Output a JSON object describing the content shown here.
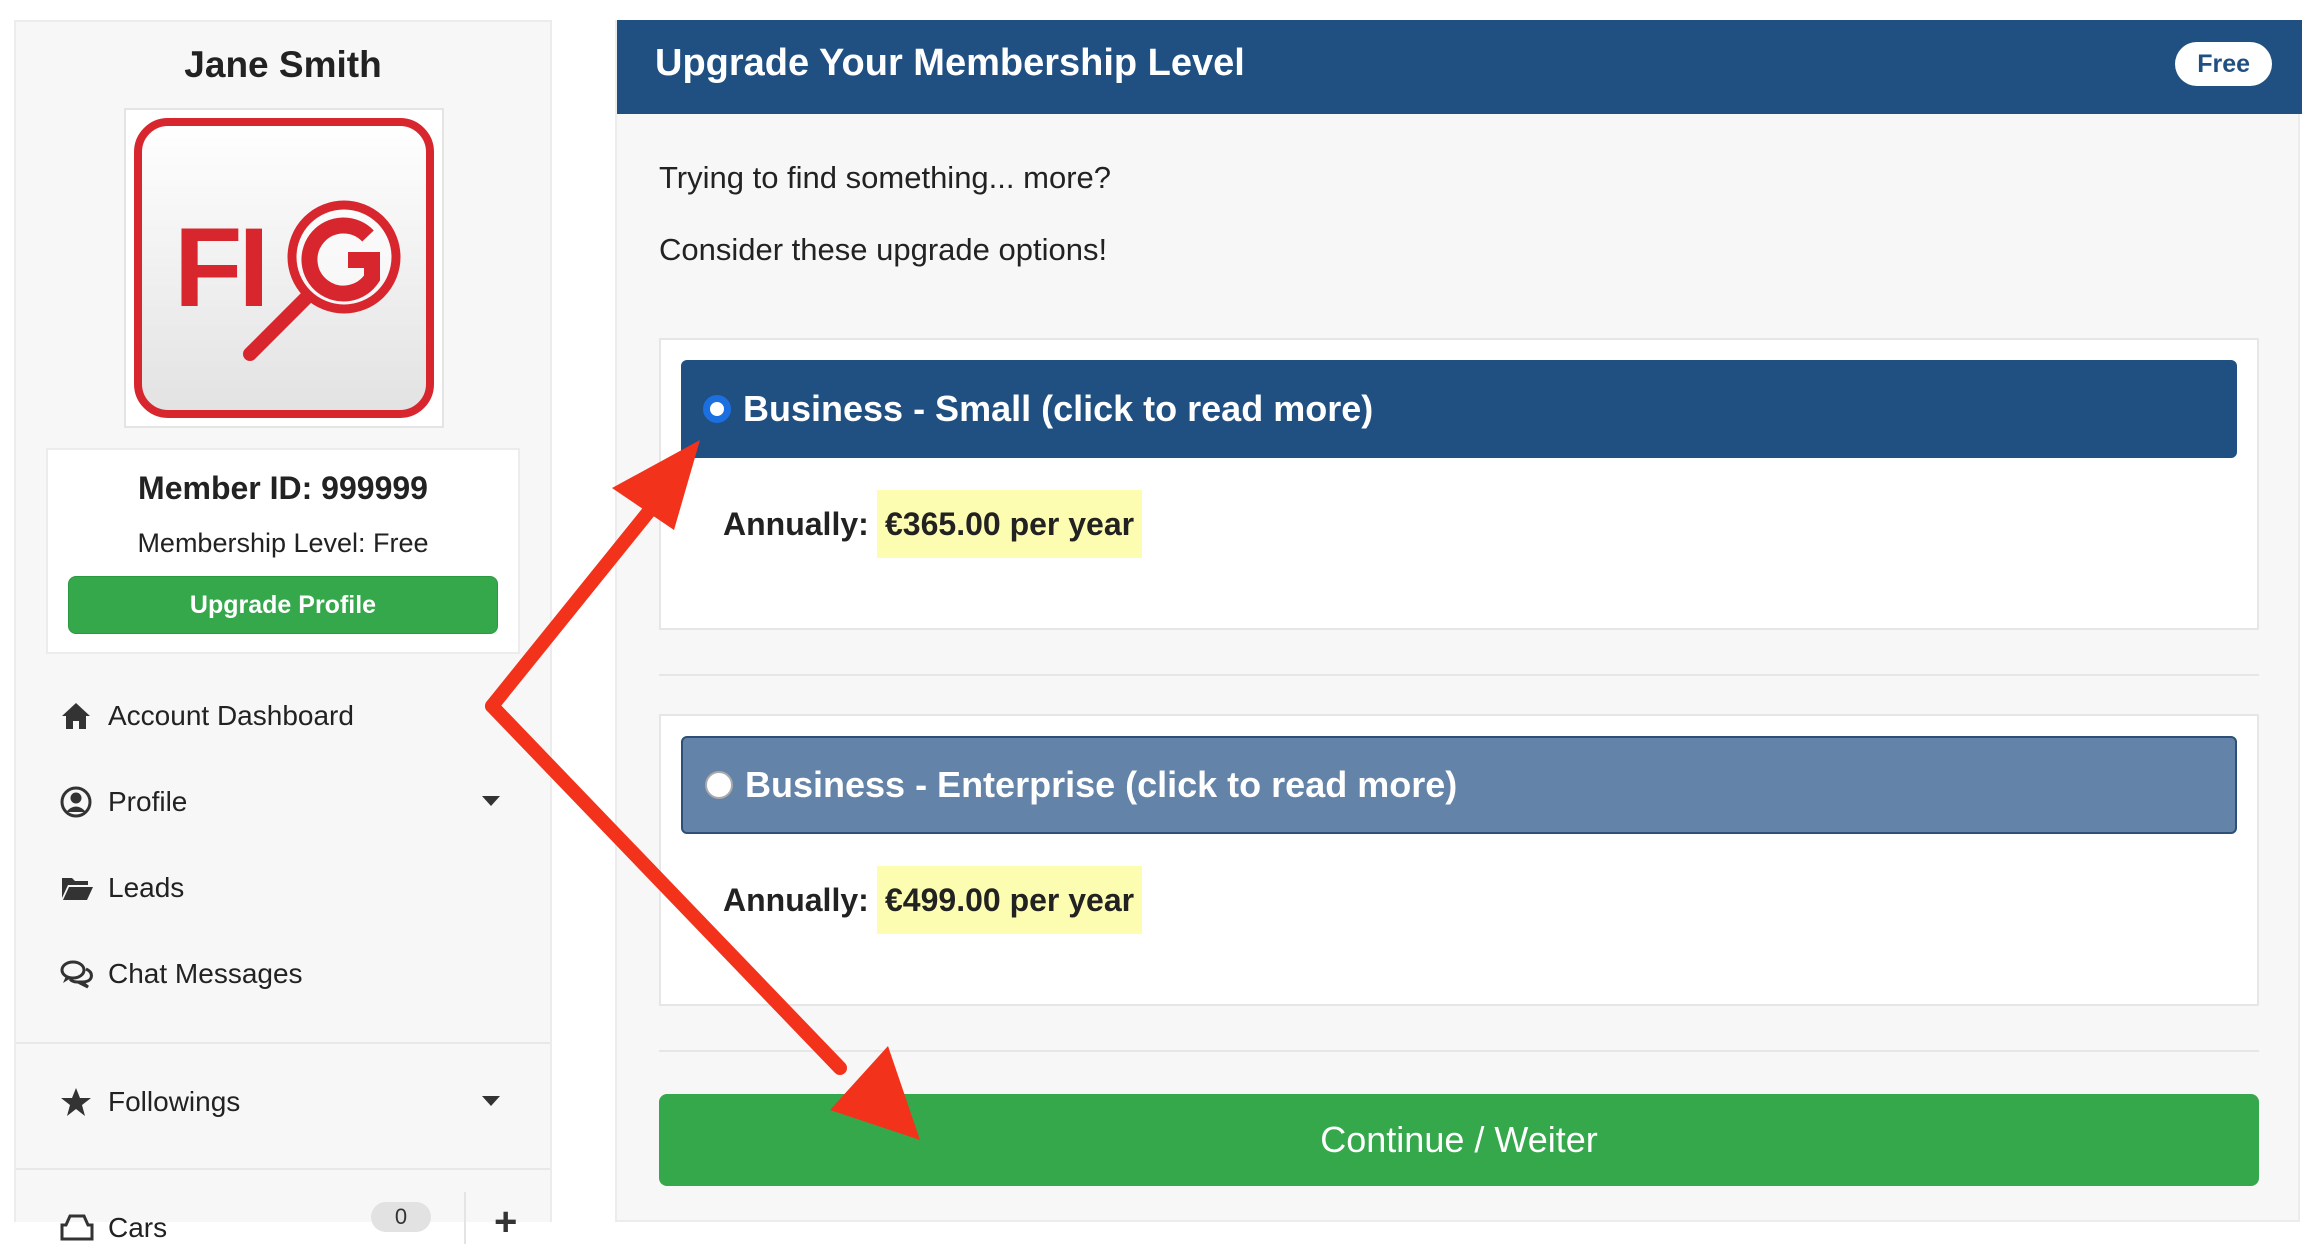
{
  "sidebar": {
    "user_name": "Jane Smith",
    "logo_text": "FIG",
    "member_id": "Member ID: 999999",
    "membership_level": "Membership Level: Free",
    "upgrade_button": "Upgrade Profile",
    "nav": [
      {
        "label": "Account Dashboard",
        "icon": "home-icon",
        "has_caret": false
      },
      {
        "label": "Profile",
        "icon": "user-circle-icon",
        "has_caret": true
      },
      {
        "label": "Leads",
        "icon": "folder-open-icon",
        "has_caret": false
      },
      {
        "label": "Chat Messages",
        "icon": "chat-bubbles-icon",
        "has_caret": false
      }
    ],
    "followings": {
      "label": "Followings",
      "icon": "star-icon"
    },
    "cart": {
      "label": "Cars",
      "icon": "car-icon",
      "count": "0",
      "add_icon": "plus-icon"
    }
  },
  "main": {
    "title": "Upgrade Your Membership Level",
    "badge": "Free",
    "intro_line1": "Trying to find something... more?",
    "intro_line2": "Consider these upgrade options!",
    "plans": [
      {
        "title": "Business - Small (click to read more)",
        "price_label": "Annually:",
        "price": "€365.00 per year",
        "selected": true
      },
      {
        "title": "Business - Enterprise (click to read more)",
        "price_label": "Annually:",
        "price": "€499.00 per year",
        "selected": false
      }
    ],
    "continue_button": "Continue / Weiter"
  },
  "colors": {
    "header_blue": "#204f82",
    "unselected_plan_blue": "#6384a8",
    "green": "#36a84c",
    "price_highlight": "#fdfdb2",
    "logo_red": "#d7262e",
    "annotation_arrow": "#f3321c"
  }
}
